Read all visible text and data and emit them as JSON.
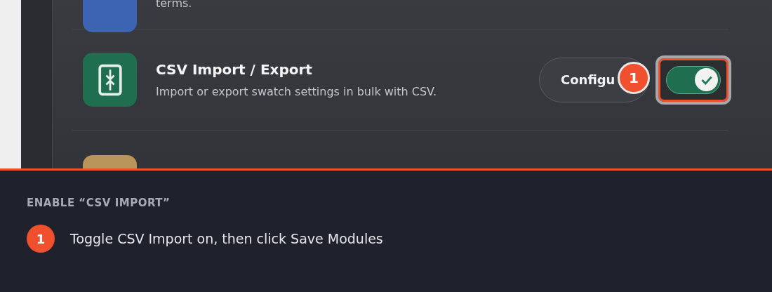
{
  "modules": [
    {
      "kind": "tail",
      "description": "terms.",
      "color": "#3d64b3"
    },
    {
      "kind": "full",
      "title": "CSV Import / Export",
      "description": "Import or export swatch settings in bulk with CSV.",
      "color": "#1f6e50",
      "button": "Configu",
      "enabled": true,
      "highlighted": true,
      "callout": "1"
    },
    {
      "kind": "head",
      "color": "#b8955a"
    }
  ],
  "instruction": {
    "heading": "ENABLE “CSV IMPORT”",
    "steps": [
      {
        "number": "1",
        "text": "Toggle CSV Import on, then click Save Modules"
      }
    ]
  }
}
